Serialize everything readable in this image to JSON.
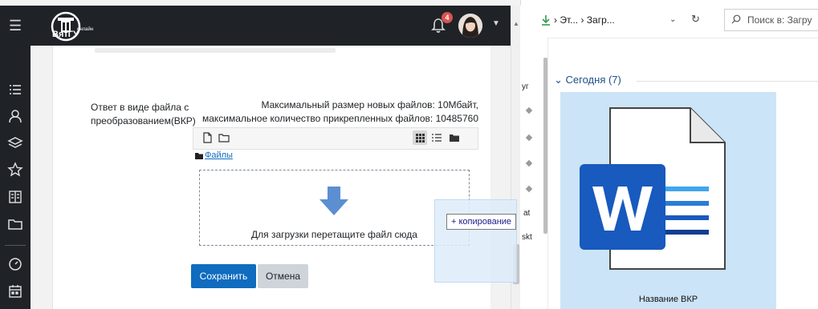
{
  "moodle": {
    "badge_count": "4",
    "logo_text": "ВятГУ",
    "logo_small": "онлайн",
    "field_label": "Ответ в виде файла с преобразованием(ВКР)",
    "max_info": "Максимальный размер новых файлов: 10Мбайт, максимальное количество прикрепленных файлов: 10485760",
    "files_link": "Файлы",
    "drop_text": "Для загрузки перетащите файл сюда",
    "save_label": "Сохранить",
    "cancel_label": "Отмена",
    "drawer_icons": [
      "list-icon",
      "graduation-icon",
      "layers-icon",
      "star-icon",
      "book-icon",
      "folder-icon",
      "dashboard-icon",
      "calendar-icon"
    ],
    "accent_color": "#0f6cbf"
  },
  "drag": {
    "tooltip": "+ копирование"
  },
  "explorer": {
    "breadcrumb": "› Эт... › Загр...",
    "search_placeholder": "Поиск в: Загру",
    "nav_fragments": [
      "уг",
      "at",
      "skt"
    ],
    "group_header": "Сегодня (7)",
    "file_name": "Название ВКР"
  }
}
